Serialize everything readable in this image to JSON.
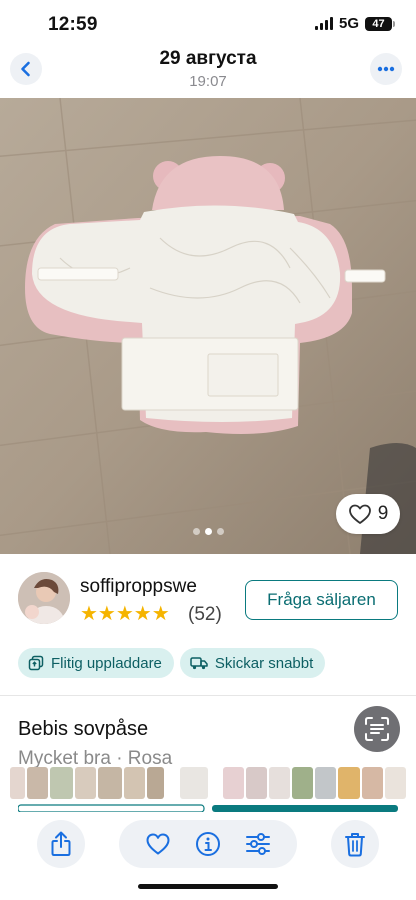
{
  "status_bar": {
    "time": "12:59",
    "network": "5G",
    "battery": "47"
  },
  "header": {
    "title": "29 августа",
    "subtitle": "19:07"
  },
  "photo": {
    "likes": "9",
    "dots_total": 3,
    "dots_active": 2
  },
  "seller": {
    "name": "soffiproppswe",
    "stars": "★★★★★",
    "reviews": "(52)",
    "ask_label": "Fråga säljaren"
  },
  "badges": [
    {
      "label": "Flitig uppladdare",
      "icon": "upload-stack-icon"
    },
    {
      "label": "Skickar snabbt",
      "icon": "truck-icon"
    }
  ],
  "item": {
    "title": "Bebis sovpåse",
    "subtitle": "Mycket bra · Rosa"
  },
  "toolbar": {
    "icons": [
      "share-icon",
      "heart-icon",
      "info-icon",
      "sliders-icon",
      "trash-icon"
    ]
  },
  "colors": {
    "accent": "#0a7a7f",
    "badge_bg": "#d9f0ef",
    "star": "#f5b400",
    "ios_blue": "#1a6fe0"
  }
}
